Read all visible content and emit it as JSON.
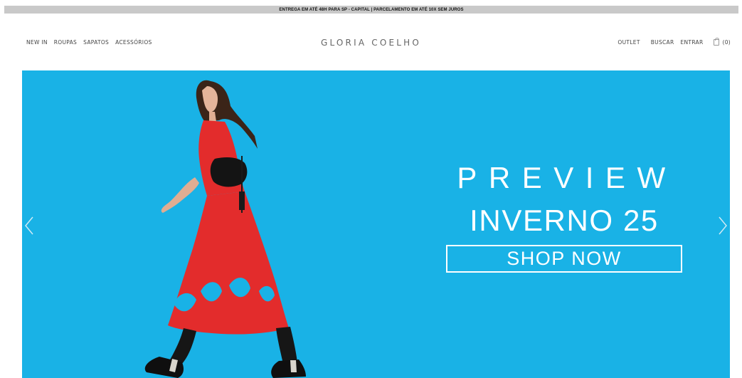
{
  "announcement": "ENTREGA EM ATÉ 48H PARA SP - CAPITAL | PARCELAMENTO EM ATÉ 10X SEM JUROS",
  "nav_left": [
    "NEW IN",
    "ROUPAS",
    "SAPATOS",
    "ACESSÓRIOS"
  ],
  "logo": "GLORIA COELHO",
  "nav_right": {
    "outlet": "OUTLET",
    "search": "BUSCAR",
    "login": "ENTRAR",
    "cart_count": "(0)"
  },
  "hero": {
    "title_line1": "PREVIEW",
    "title_line2": "INVERNO 25",
    "cta": "SHOP NOW",
    "background_color": "#19b2e6"
  },
  "icons": {
    "cart": "shopping-bag-icon",
    "prev": "chevron-left-icon",
    "next": "chevron-right-icon"
  }
}
